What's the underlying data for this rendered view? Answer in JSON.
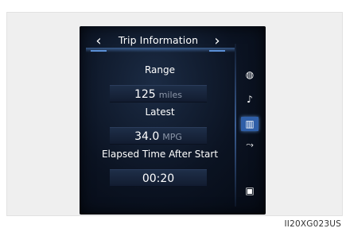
{
  "header": {
    "title": "Trip Information",
    "prev_arrow": "‹",
    "next_arrow": "›"
  },
  "rows": [
    {
      "label": "Range",
      "value": "125",
      "unit": "miles"
    },
    {
      "label": "Latest",
      "value": "34.0",
      "unit": "MPG"
    },
    {
      "label": "Elapsed Time After Start",
      "value": "00:20",
      "unit": ""
    }
  ],
  "sidebar": {
    "icons": [
      {
        "name": "eco-gauge-icon",
        "glyph": "◍",
        "active": false
      },
      {
        "name": "music-note-icon",
        "glyph": "♪",
        "active": false
      },
      {
        "name": "bar-graph-icon",
        "glyph": "▥",
        "active": true
      },
      {
        "name": "car-settings-icon",
        "glyph": "⤳",
        "active": false
      },
      {
        "name": "screen-display-icon",
        "glyph": "▣",
        "active": false
      }
    ]
  },
  "caption": "II20XG023US",
  "colors": {
    "accent": "#2f5fa8",
    "screen_bg": "#0b1322",
    "unit_text": "#8c97a9"
  }
}
